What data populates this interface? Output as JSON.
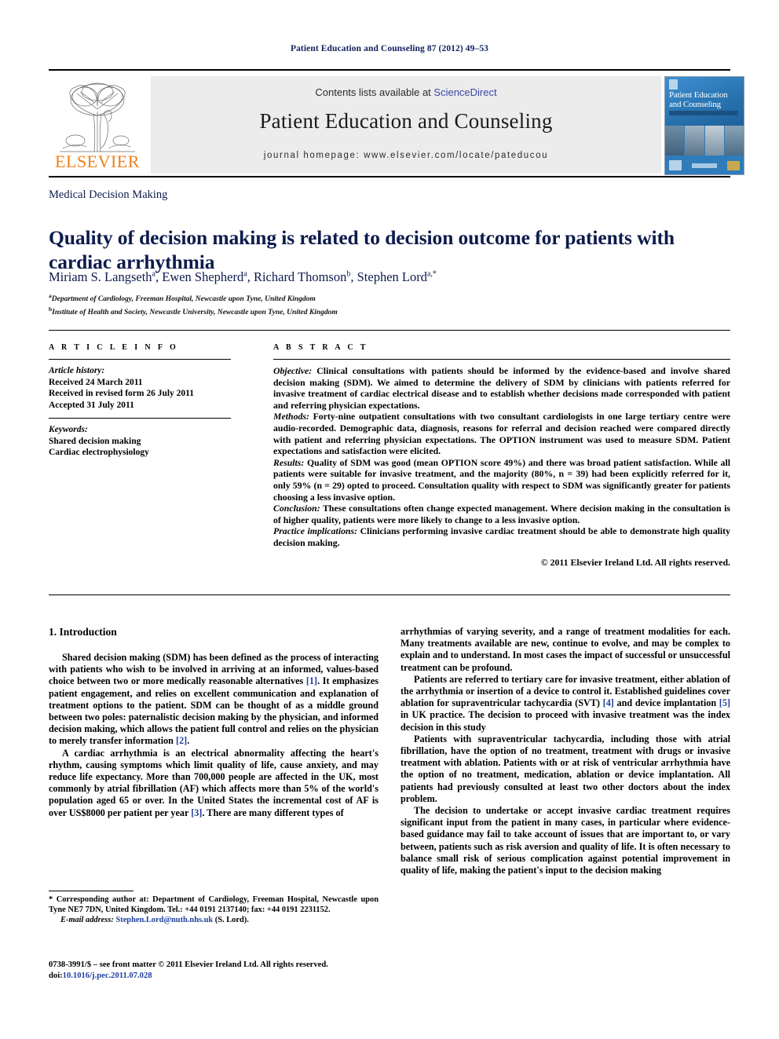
{
  "running_head": "Patient Education and Counseling 87 (2012) 49–53",
  "masthead": {
    "publisher_wordmark": "ELSEVIER",
    "contents_prefix": "Contents lists available at ",
    "contents_link": "ScienceDirect",
    "journal_title": "Patient Education and Counseling",
    "homepage": "journal homepage: www.elsevier.com/locate/pateducou",
    "cover": {
      "line1": "Patient Education",
      "line2": "and Counseling"
    },
    "accent_link_color": "#3b47a8",
    "band_color": "#ececec",
    "elsevier_orange": "#f07f1a"
  },
  "article": {
    "section": "Medical Decision Making",
    "title": "Quality of decision making is related to decision outcome for patients with cardiac arrhythmia",
    "authors": [
      {
        "name": "Miriam S. Langseth",
        "marks": "a"
      },
      {
        "name": "Ewen Shepherd",
        "marks": "a"
      },
      {
        "name": "Richard Thomson",
        "marks": "b"
      },
      {
        "name": "Stephen Lord",
        "marks": "a,*"
      }
    ],
    "affiliations": [
      {
        "mark": "a",
        "text": "Department of Cardiology, Freeman Hospital, Newcastle upon Tyne, United Kingdom"
      },
      {
        "mark": "b",
        "text": "Institute of Health and Society, Newcastle University, Newcastle upon Tyne, United Kingdom"
      }
    ],
    "title_color": "#0d1b4c"
  },
  "article_info": {
    "heading": "A R T I C L E   I N F O",
    "history_label": "Article history:",
    "history": [
      "Received 24 March 2011",
      "Received in revised form 26 July 2011",
      "Accepted 31 July 2011"
    ],
    "keywords_label": "Keywords:",
    "keywords": [
      "Shared decision making",
      "Cardiac electrophysiology"
    ]
  },
  "abstract": {
    "heading": "A B S T R A C T",
    "sections": [
      {
        "label": "Objective:",
        "text": " Clinical consultations with patients should be informed by the evidence-based and involve shared decision making (SDM). We aimed to determine the delivery of SDM by clinicians with patients referred for invasive treatment of cardiac electrical disease and to establish whether decisions made corresponded with patient and referring physician expectations."
      },
      {
        "label": "Methods:",
        "text": " Forty-nine outpatient consultations with two consultant cardiologists in one large tertiary centre were audio-recorded. Demographic data, diagnosis, reasons for referral and decision reached were compared directly with patient and referring physician expectations. The OPTION instrument was used to measure SDM. Patient expectations and satisfaction were elicited."
      },
      {
        "label": "Results:",
        "text": " Quality of SDM was good (mean OPTION score 49%) and there was broad patient satisfaction. While all patients were suitable for invasive treatment, and the majority (80%, n = 39) had been explicitly referred for it, only 59% (n = 29) opted to proceed. Consultation quality with respect to SDM was significantly greater for patients choosing a less invasive option."
      },
      {
        "label": "Conclusion:",
        "text": " These consultations often change expected management. Where decision making in the consultation is of higher quality, patients were more likely to change to a less invasive option."
      },
      {
        "label": "Practice implications:",
        "text": " Clinicians performing invasive cardiac treatment should be able to demonstrate high quality decision making."
      }
    ],
    "copyright": "© 2011 Elsevier Ireland Ltd. All rights reserved."
  },
  "body": {
    "intro_heading": "1. Introduction",
    "left_paragraphs": [
      "Shared decision making (SDM) has been defined as the process of interacting with patients who wish to be involved in arriving at an informed, values-based choice between two or more medically reasonable alternatives [1]. It emphasizes patient engagement, and relies on excellent communication and explanation of treatment options to the patient. SDM can be thought of as a middle ground between two poles: paternalistic decision making by the physician, and informed decision making, which allows the patient full control and relies on the physician to merely transfer information [2].",
      "A cardiac arrhythmia is an electrical abnormality affecting the heart's rhythm, causing symptoms which limit quality of life, cause anxiety, and may reduce life expectancy. More than 700,000 people are affected in the UK, most commonly by atrial fibrillation (AF) which affects more than 5% of the world's population aged 65 or over. In the United States the incremental cost of AF is over US$8000 per patient per year [3]. There are many different types of"
    ],
    "right_paragraphs": [
      "arrhythmias of varying severity, and a range of treatment modalities for each. Many treatments available are new, continue to evolve, and may be complex to explain and to understand. In most cases the impact of successful or unsuccessful treatment can be profound.",
      "Patients are referred to tertiary care for invasive treatment, either ablation of the arrhythmia or insertion of a device to control it. Established guidelines cover ablation for supraventricular tachycardia (SVT) [4] and device implantation [5] in UK practice. The decision to proceed with invasive treatment was the index decision in this study",
      "Patients with supraventricular tachycardia, including those with atrial fibrillation, have the option of no treatment, treatment with drugs or invasive treatment with ablation. Patients with or at risk of ventricular arrhythmia have the option of no treatment, medication, ablation or device implantation. All patients had previously consulted at least two other doctors about the index problem.",
      "The decision to undertake or accept invasive cardiac treatment requires significant input from the patient in many cases, in particular where evidence-based guidance may fail to take account of issues that are important to, or vary between, patients such as risk aversion and quality of life. It is often necessary to balance small risk of serious complication against potential improvement in quality of life, making the patient's input to the decision making"
    ]
  },
  "footnotes": {
    "corresponding": "* Corresponding author at: Department of Cardiology, Freeman Hospital, Newcastle upon Tyne NE7 7DN, United Kingdom. Tel.: +44 0191 2137140; fax: +44 0191 2231152.",
    "email_label": "E-mail address:",
    "email": "Stephen.Lord@nuth.nhs.uk",
    "email_owner": "(S. Lord).",
    "imprint": "0738-3991/$ – see front matter © 2011 Elsevier Ireland Ltd. All rights reserved.",
    "doi_label": "doi:",
    "doi": "10.1016/j.pec.2011.07.028"
  }
}
